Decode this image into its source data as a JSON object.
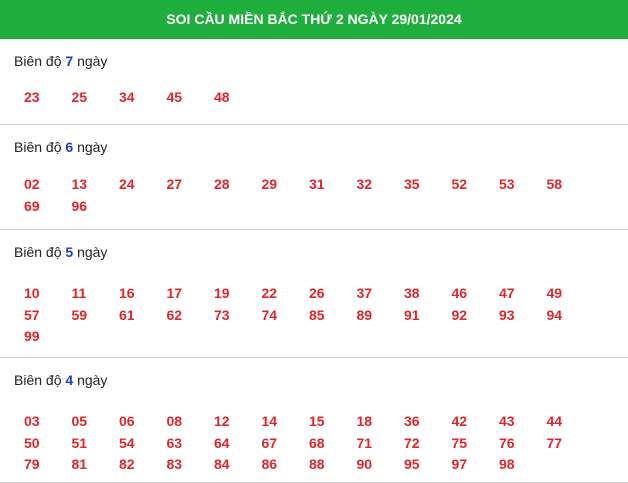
{
  "header": {
    "title": "SOI CẦU MIỀN BẮC THỨ 2 NGÀY 29/01/2024"
  },
  "sections": [
    {
      "prefix": "Biên độ",
      "days": "7",
      "suffix": "ngày",
      "numbers": [
        "23",
        "25",
        "34",
        "45",
        "48"
      ]
    },
    {
      "prefix": "Biên độ",
      "days": "6",
      "suffix": "ngày",
      "numbers": [
        "02",
        "13",
        "24",
        "27",
        "28",
        "29",
        "31",
        "32",
        "35",
        "52",
        "53",
        "58",
        "69",
        "96"
      ]
    },
    {
      "prefix": "Biên độ",
      "days": "5",
      "suffix": "ngày",
      "numbers": [
        "10",
        "11",
        "16",
        "17",
        "19",
        "22",
        "26",
        "37",
        "38",
        "46",
        "47",
        "49",
        "57",
        "59",
        "61",
        "62",
        "73",
        "74",
        "85",
        "89",
        "91",
        "92",
        "93",
        "94",
        "99"
      ]
    },
    {
      "prefix": "Biên độ",
      "days": "4",
      "suffix": "ngày",
      "numbers": [
        "03",
        "05",
        "06",
        "08",
        "12",
        "14",
        "15",
        "18",
        "36",
        "42",
        "43",
        "44",
        "50",
        "51",
        "54",
        "63",
        "64",
        "67",
        "68",
        "71",
        "72",
        "75",
        "76",
        "77",
        "79",
        "81",
        "82",
        "83",
        "84",
        "86",
        "88",
        "90",
        "95",
        "97",
        "98"
      ]
    }
  ],
  "colors": {
    "header_bg": "#1fad3e",
    "number": "#e0262b",
    "day_count": "#1a3fc7"
  }
}
